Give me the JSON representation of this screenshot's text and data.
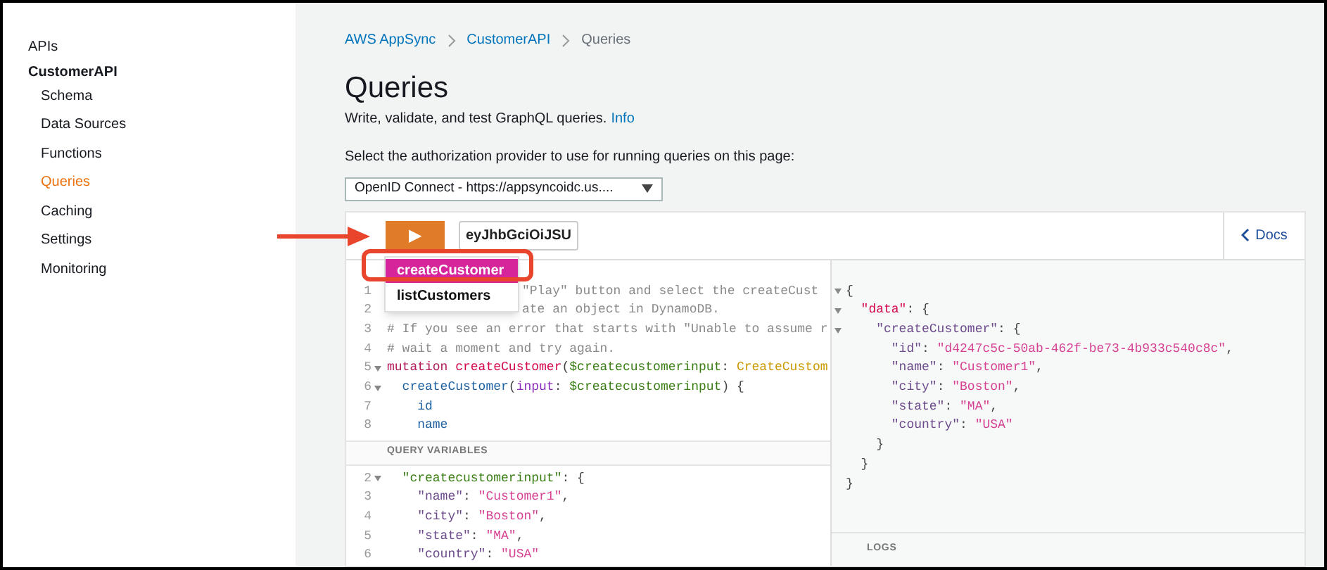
{
  "sidebar": {
    "items": [
      {
        "label": "APIs",
        "kind": "top",
        "selected": false
      },
      {
        "label": "CustomerAPI",
        "kind": "group",
        "selected": false
      },
      {
        "label": "Schema",
        "kind": "sub",
        "selected": false
      },
      {
        "label": "Data Sources",
        "kind": "sub",
        "selected": false
      },
      {
        "label": "Functions",
        "kind": "sub",
        "selected": false
      },
      {
        "label": "Queries",
        "kind": "sub",
        "selected": true
      },
      {
        "label": "Caching",
        "kind": "sub",
        "selected": false
      },
      {
        "label": "Settings",
        "kind": "sub",
        "selected": false
      },
      {
        "label": "Monitoring",
        "kind": "sub",
        "selected": false
      }
    ]
  },
  "breadcrumb": [
    {
      "label": "AWS AppSync",
      "link": true
    },
    {
      "label": "CustomerAPI",
      "link": true
    },
    {
      "label": "Queries",
      "link": false
    }
  ],
  "page": {
    "title": "Queries",
    "description": "Write, validate, and test GraphQL queries.",
    "info_link": "Info",
    "provider_label": "Select the authorization provider to use for running queries on this page:",
    "provider_value": "OpenID Connect - https://appsyncoidc.us...."
  },
  "toolbar": {
    "play_icon": "▶",
    "token": "eyJhbGciOiJSU",
    "docs": "Docs"
  },
  "operation_menu": [
    {
      "label": "createCustomer",
      "selected": true
    },
    {
      "label": "listCustomers",
      "selected": false
    }
  ],
  "query_editor": {
    "lines": [
      {
        "number": "1",
        "fold": false,
        "covered": true,
        "segments": [
          {
            "kind": "comment",
            "text": "\"Play\" button and select the createCust"
          }
        ]
      },
      {
        "number": "2",
        "fold": false,
        "covered": true,
        "segments": [
          {
            "kind": "comment",
            "text": "ate an object in DynamoDB."
          }
        ]
      },
      {
        "number": "3",
        "fold": false,
        "covered": false,
        "segments": [
          {
            "kind": "comment",
            "text": "# If you see an error that starts with \"Unable to assume r"
          }
        ]
      },
      {
        "number": "4",
        "fold": false,
        "covered": false,
        "segments": [
          {
            "kind": "comment",
            "text": "# wait a moment and try again."
          }
        ]
      },
      {
        "number": "5",
        "fold": true,
        "covered": false,
        "segments": [
          {
            "kind": "keyword",
            "text": "mutation "
          },
          {
            "kind": "def",
            "text": "createCustomer"
          },
          {
            "kind": "plain",
            "text": "("
          },
          {
            "kind": "variable",
            "text": "$createcustomerinput"
          },
          {
            "kind": "plain",
            "text": ": "
          },
          {
            "kind": "type",
            "text": "CreateCustom"
          }
        ]
      },
      {
        "number": "6",
        "fold": true,
        "covered": false,
        "segments": [
          {
            "kind": "property",
            "text": "  createCustomer"
          },
          {
            "kind": "plain",
            "text": "("
          },
          {
            "kind": "attribute",
            "text": "input"
          },
          {
            "kind": "plain",
            "text": ": "
          },
          {
            "kind": "variable",
            "text": "$createcustomerinput"
          },
          {
            "kind": "plain",
            "text": ") {"
          }
        ]
      },
      {
        "number": "7",
        "fold": false,
        "covered": false,
        "segments": [
          {
            "kind": "property",
            "text": "    id"
          }
        ]
      },
      {
        "number": "8",
        "fold": false,
        "covered": false,
        "segments": [
          {
            "kind": "property",
            "text": "    name"
          }
        ]
      }
    ]
  },
  "variables_editor": {
    "title": "QUERY VARIABLES",
    "lines": [
      {
        "number": "2",
        "fold": true,
        "segments": [
          {
            "kind": "variable",
            "text": "  \"createcustomerinput\""
          },
          {
            "kind": "plain",
            "text": ": {"
          }
        ]
      },
      {
        "number": "3",
        "fold": false,
        "segments": [
          {
            "kind": "key",
            "text": "    \"name\""
          },
          {
            "kind": "plain",
            "text": ": "
          },
          {
            "kind": "string",
            "text": "\"Customer1\""
          },
          {
            "kind": "plain",
            "text": ","
          }
        ]
      },
      {
        "number": "4",
        "fold": false,
        "segments": [
          {
            "kind": "key",
            "text": "    \"city\""
          },
          {
            "kind": "plain",
            "text": ": "
          },
          {
            "kind": "string",
            "text": "\"Boston\""
          },
          {
            "kind": "plain",
            "text": ","
          }
        ]
      },
      {
        "number": "5",
        "fold": false,
        "segments": [
          {
            "kind": "key",
            "text": "    \"state\""
          },
          {
            "kind": "plain",
            "text": ": "
          },
          {
            "kind": "string",
            "text": "\"MA\""
          },
          {
            "kind": "plain",
            "text": ","
          }
        ]
      },
      {
        "number": "6",
        "fold": false,
        "segments": [
          {
            "kind": "key",
            "text": "    \"country\""
          },
          {
            "kind": "plain",
            "text": ": "
          },
          {
            "kind": "string",
            "text": "\"USA\""
          }
        ]
      }
    ]
  },
  "result": {
    "lines": [
      {
        "fold": true,
        "segments": [
          {
            "kind": "plain",
            "text": "{"
          }
        ]
      },
      {
        "fold": true,
        "segments": [
          {
            "kind": "def",
            "text": "  \"data\""
          },
          {
            "kind": "plain",
            "text": ": {"
          }
        ]
      },
      {
        "fold": true,
        "segments": [
          {
            "kind": "key",
            "text": "    \"createCustomer\""
          },
          {
            "kind": "plain",
            "text": ": {"
          }
        ]
      },
      {
        "fold": false,
        "segments": [
          {
            "kind": "key",
            "text": "      \"id\""
          },
          {
            "kind": "plain",
            "text": ": "
          },
          {
            "kind": "string",
            "text": "\"d4247c5c-50ab-462f-be73-4b933c540c8c\""
          },
          {
            "kind": "plain",
            "text": ","
          }
        ]
      },
      {
        "fold": false,
        "segments": [
          {
            "kind": "key",
            "text": "      \"name\""
          },
          {
            "kind": "plain",
            "text": ": "
          },
          {
            "kind": "string",
            "text": "\"Customer1\""
          },
          {
            "kind": "plain",
            "text": ","
          }
        ]
      },
      {
        "fold": false,
        "segments": [
          {
            "kind": "key",
            "text": "      \"city\""
          },
          {
            "kind": "plain",
            "text": ": "
          },
          {
            "kind": "string",
            "text": "\"Boston\""
          },
          {
            "kind": "plain",
            "text": ","
          }
        ]
      },
      {
        "fold": false,
        "segments": [
          {
            "kind": "key",
            "text": "      \"state\""
          },
          {
            "kind": "plain",
            "text": ": "
          },
          {
            "kind": "string",
            "text": "\"MA\""
          },
          {
            "kind": "plain",
            "text": ","
          }
        ]
      },
      {
        "fold": false,
        "segments": [
          {
            "kind": "key",
            "text": "      \"country\""
          },
          {
            "kind": "plain",
            "text": ": "
          },
          {
            "kind": "string",
            "text": "\"USA\""
          }
        ]
      },
      {
        "fold": false,
        "segments": [
          {
            "kind": "plain",
            "text": "    }"
          }
        ]
      },
      {
        "fold": false,
        "segments": [
          {
            "kind": "plain",
            "text": "  }"
          }
        ]
      },
      {
        "fold": false,
        "segments": [
          {
            "kind": "plain",
            "text": "}"
          }
        ]
      }
    ],
    "logs_title": "LOGS"
  }
}
